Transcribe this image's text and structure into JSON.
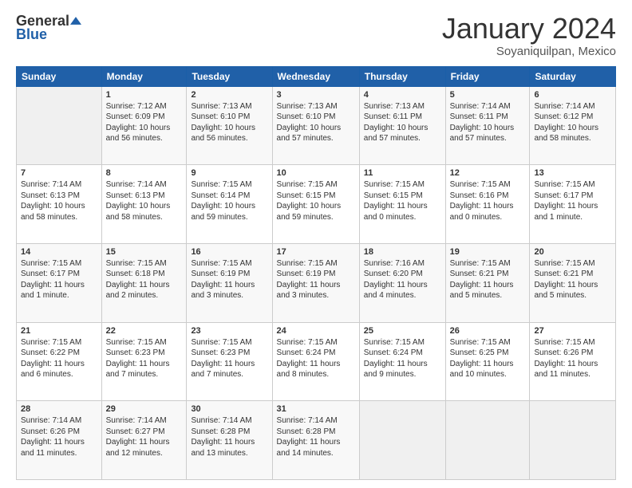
{
  "header": {
    "logo_general": "General",
    "logo_blue": "Blue",
    "month": "January 2024",
    "location": "Soyaniquilpan, Mexico"
  },
  "days_of_week": [
    "Sunday",
    "Monday",
    "Tuesday",
    "Wednesday",
    "Thursday",
    "Friday",
    "Saturday"
  ],
  "weeks": [
    [
      {
        "day": "",
        "sunrise": "",
        "sunset": "",
        "daylight": "",
        "empty": true
      },
      {
        "day": "1",
        "sunrise": "Sunrise: 7:12 AM",
        "sunset": "Sunset: 6:09 PM",
        "daylight": "Daylight: 10 hours and 56 minutes."
      },
      {
        "day": "2",
        "sunrise": "Sunrise: 7:13 AM",
        "sunset": "Sunset: 6:10 PM",
        "daylight": "Daylight: 10 hours and 56 minutes."
      },
      {
        "day": "3",
        "sunrise": "Sunrise: 7:13 AM",
        "sunset": "Sunset: 6:10 PM",
        "daylight": "Daylight: 10 hours and 57 minutes."
      },
      {
        "day": "4",
        "sunrise": "Sunrise: 7:13 AM",
        "sunset": "Sunset: 6:11 PM",
        "daylight": "Daylight: 10 hours and 57 minutes."
      },
      {
        "day": "5",
        "sunrise": "Sunrise: 7:14 AM",
        "sunset": "Sunset: 6:11 PM",
        "daylight": "Daylight: 10 hours and 57 minutes."
      },
      {
        "day": "6",
        "sunrise": "Sunrise: 7:14 AM",
        "sunset": "Sunset: 6:12 PM",
        "daylight": "Daylight: 10 hours and 58 minutes."
      }
    ],
    [
      {
        "day": "7",
        "sunrise": "Sunrise: 7:14 AM",
        "sunset": "Sunset: 6:13 PM",
        "daylight": "Daylight: 10 hours and 58 minutes."
      },
      {
        "day": "8",
        "sunrise": "Sunrise: 7:14 AM",
        "sunset": "Sunset: 6:13 PM",
        "daylight": "Daylight: 10 hours and 58 minutes."
      },
      {
        "day": "9",
        "sunrise": "Sunrise: 7:15 AM",
        "sunset": "Sunset: 6:14 PM",
        "daylight": "Daylight: 10 hours and 59 minutes."
      },
      {
        "day": "10",
        "sunrise": "Sunrise: 7:15 AM",
        "sunset": "Sunset: 6:15 PM",
        "daylight": "Daylight: 10 hours and 59 minutes."
      },
      {
        "day": "11",
        "sunrise": "Sunrise: 7:15 AM",
        "sunset": "Sunset: 6:15 PM",
        "daylight": "Daylight: 11 hours and 0 minutes."
      },
      {
        "day": "12",
        "sunrise": "Sunrise: 7:15 AM",
        "sunset": "Sunset: 6:16 PM",
        "daylight": "Daylight: 11 hours and 0 minutes."
      },
      {
        "day": "13",
        "sunrise": "Sunrise: 7:15 AM",
        "sunset": "Sunset: 6:17 PM",
        "daylight": "Daylight: 11 hours and 1 minute."
      }
    ],
    [
      {
        "day": "14",
        "sunrise": "Sunrise: 7:15 AM",
        "sunset": "Sunset: 6:17 PM",
        "daylight": "Daylight: 11 hours and 1 minute."
      },
      {
        "day": "15",
        "sunrise": "Sunrise: 7:15 AM",
        "sunset": "Sunset: 6:18 PM",
        "daylight": "Daylight: 11 hours and 2 minutes."
      },
      {
        "day": "16",
        "sunrise": "Sunrise: 7:15 AM",
        "sunset": "Sunset: 6:19 PM",
        "daylight": "Daylight: 11 hours and 3 minutes."
      },
      {
        "day": "17",
        "sunrise": "Sunrise: 7:15 AM",
        "sunset": "Sunset: 6:19 PM",
        "daylight": "Daylight: 11 hours and 3 minutes."
      },
      {
        "day": "18",
        "sunrise": "Sunrise: 7:16 AM",
        "sunset": "Sunset: 6:20 PM",
        "daylight": "Daylight: 11 hours and 4 minutes."
      },
      {
        "day": "19",
        "sunrise": "Sunrise: 7:15 AM",
        "sunset": "Sunset: 6:21 PM",
        "daylight": "Daylight: 11 hours and 5 minutes."
      },
      {
        "day": "20",
        "sunrise": "Sunrise: 7:15 AM",
        "sunset": "Sunset: 6:21 PM",
        "daylight": "Daylight: 11 hours and 5 minutes."
      }
    ],
    [
      {
        "day": "21",
        "sunrise": "Sunrise: 7:15 AM",
        "sunset": "Sunset: 6:22 PM",
        "daylight": "Daylight: 11 hours and 6 minutes."
      },
      {
        "day": "22",
        "sunrise": "Sunrise: 7:15 AM",
        "sunset": "Sunset: 6:23 PM",
        "daylight": "Daylight: 11 hours and 7 minutes."
      },
      {
        "day": "23",
        "sunrise": "Sunrise: 7:15 AM",
        "sunset": "Sunset: 6:23 PM",
        "daylight": "Daylight: 11 hours and 7 minutes."
      },
      {
        "day": "24",
        "sunrise": "Sunrise: 7:15 AM",
        "sunset": "Sunset: 6:24 PM",
        "daylight": "Daylight: 11 hours and 8 minutes."
      },
      {
        "day": "25",
        "sunrise": "Sunrise: 7:15 AM",
        "sunset": "Sunset: 6:24 PM",
        "daylight": "Daylight: 11 hours and 9 minutes."
      },
      {
        "day": "26",
        "sunrise": "Sunrise: 7:15 AM",
        "sunset": "Sunset: 6:25 PM",
        "daylight": "Daylight: 11 hours and 10 minutes."
      },
      {
        "day": "27",
        "sunrise": "Sunrise: 7:15 AM",
        "sunset": "Sunset: 6:26 PM",
        "daylight": "Daylight: 11 hours and 11 minutes."
      }
    ],
    [
      {
        "day": "28",
        "sunrise": "Sunrise: 7:14 AM",
        "sunset": "Sunset: 6:26 PM",
        "daylight": "Daylight: 11 hours and 11 minutes."
      },
      {
        "day": "29",
        "sunrise": "Sunrise: 7:14 AM",
        "sunset": "Sunset: 6:27 PM",
        "daylight": "Daylight: 11 hours and 12 minutes."
      },
      {
        "day": "30",
        "sunrise": "Sunrise: 7:14 AM",
        "sunset": "Sunset: 6:28 PM",
        "daylight": "Daylight: 11 hours and 13 minutes."
      },
      {
        "day": "31",
        "sunrise": "Sunrise: 7:14 AM",
        "sunset": "Sunset: 6:28 PM",
        "daylight": "Daylight: 11 hours and 14 minutes."
      },
      {
        "day": "",
        "sunrise": "",
        "sunset": "",
        "daylight": "",
        "empty": true
      },
      {
        "day": "",
        "sunrise": "",
        "sunset": "",
        "daylight": "",
        "empty": true
      },
      {
        "day": "",
        "sunrise": "",
        "sunset": "",
        "daylight": "",
        "empty": true
      }
    ]
  ]
}
